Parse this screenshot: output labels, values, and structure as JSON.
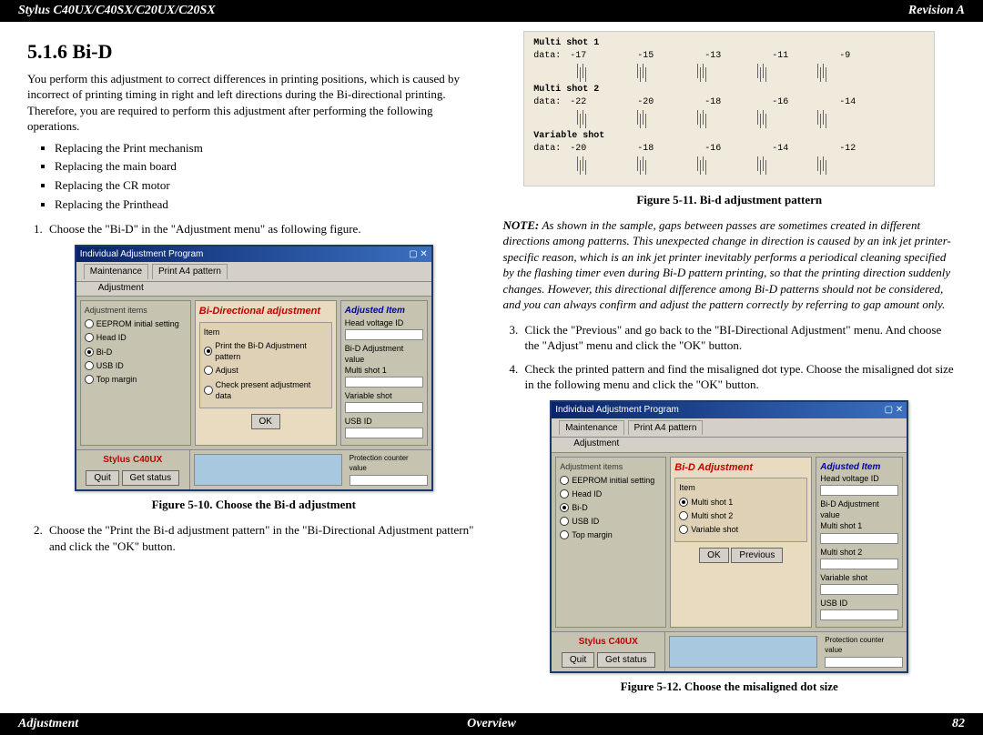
{
  "header": {
    "left": "Stylus C40UX/C40SX/C20UX/C20SX",
    "right": "Revision A"
  },
  "footer": {
    "left": "Adjustment",
    "center": "Overview",
    "right": "82"
  },
  "section": {
    "number_title": "5.1.6  Bi-D",
    "intro": "You perform this adjustment to correct differences in printing positions, which is caused by incorrect of printing timing in right and left directions during the Bi-directional printing. Therefore, you are required to perform this adjustment after performing the following operations.",
    "bullets": [
      "Replacing the Print mechanism",
      "Replacing the main board",
      "Replacing the CR motor",
      "Replacing the Printhead"
    ],
    "step1": "Choose the \"Bi-D\" in the \"Adjustment menu\" as following figure.",
    "fig10": "Figure 5-10.  Choose the Bi-d adjustment",
    "step2": "Choose the \"Print the Bi-d adjustment pattern\" in the \"Bi-Directional Adjustment pattern\" and click the \"OK\" button.",
    "fig11": "Figure 5-11.  Bi-d adjustment pattern",
    "note": "As shown in the sample, gaps between passes are sometimes created in different directions among patterns. This unexpected change in direction is caused by an ink jet printer-specific reason, which is an ink jet printer inevitably performs a periodical cleaning specified by the flashing timer even during Bi-D pattern printing, so that the printing direction suddenly changes. However, this directional difference among Bi-D patterns should not be considered, and you can always confirm and adjust the pattern correctly by referring to gap amount only.",
    "step3": "Click the \"Previous\" and go back to the \"BI-Directional Adjustment\" menu. And choose the \"Adjust\" menu and click the \"OK\" button.",
    "step4a": "Check the printed pattern and find the misaligned dot type. ",
    "step4b": "Choose the misaligned dot size in the following menu and click the \"OK\" button.",
    "fig12": "Figure 5-12.  Choose the misaligned dot size"
  },
  "dialog10": {
    "titlebar": "Individual Adjustment Program",
    "tabs": [
      "Maintenance",
      "Print A4 pattern",
      "Adjustment"
    ],
    "left_title": "Adjustment items",
    "left_items": [
      "EEPROM initial setting",
      "Head ID",
      "Bi-D",
      "USB ID",
      "Top margin"
    ],
    "selected_index": 2,
    "center_title": "Bi-Directional adjustment",
    "item_label": "Item",
    "center_items": [
      "Print the Bi-D Adjustment pattern",
      "Adjust",
      "Check present adjustment data"
    ],
    "center_selected": 0,
    "ok": "OK",
    "previous": "",
    "right_title": "Adjusted Item",
    "right_fields": [
      "Head voltage ID",
      "Bi-D Adjustment value",
      "Multi shot 1",
      "Variable shot",
      "USB ID",
      "Protection counter value"
    ],
    "model": "Stylus C40UX",
    "quit": "Quit",
    "get_status": "Get status"
  },
  "dialog12": {
    "titlebar": "Individual Adjustment Program",
    "tabs": [
      "Maintenance",
      "Print A4 pattern",
      "Adjustment"
    ],
    "left_title": "Adjustment items",
    "left_items": [
      "EEPROM initial setting",
      "Head ID",
      "Bi-D",
      "USB ID",
      "Top margin"
    ],
    "selected_index": 2,
    "center_title": "Bi-D Adjustment",
    "item_label": "Item",
    "center_items": [
      "Multi shot 1",
      "Multi shot 2",
      "Variable shot"
    ],
    "center_selected": 0,
    "ok": "OK",
    "previous": "Previous",
    "right_title": "Adjusted Item",
    "right_fields": [
      "Head voltage ID",
      "Bi-D Adjustment value",
      "Multi shot 1",
      "Multi shot 2",
      "Variable shot",
      "USB ID",
      "Protection counter value"
    ],
    "model": "Stylus C40UX",
    "quit": "Quit",
    "get_status": "Get status"
  },
  "pattern": {
    "rows": [
      {
        "label": "Multi shot 1",
        "data_label": "data:",
        "values": [
          "-17",
          "-15",
          "-13",
          "-11",
          "-9"
        ]
      },
      {
        "label": "Multi shot 2",
        "data_label": "data:",
        "values": [
          "-22",
          "-20",
          "-18",
          "-16",
          "-14"
        ]
      },
      {
        "label": "Variable shot",
        "data_label": "data:",
        "values": [
          "-20",
          "-18",
          "-16",
          "-14",
          "-12"
        ]
      }
    ]
  },
  "note_label": "NOTE:"
}
